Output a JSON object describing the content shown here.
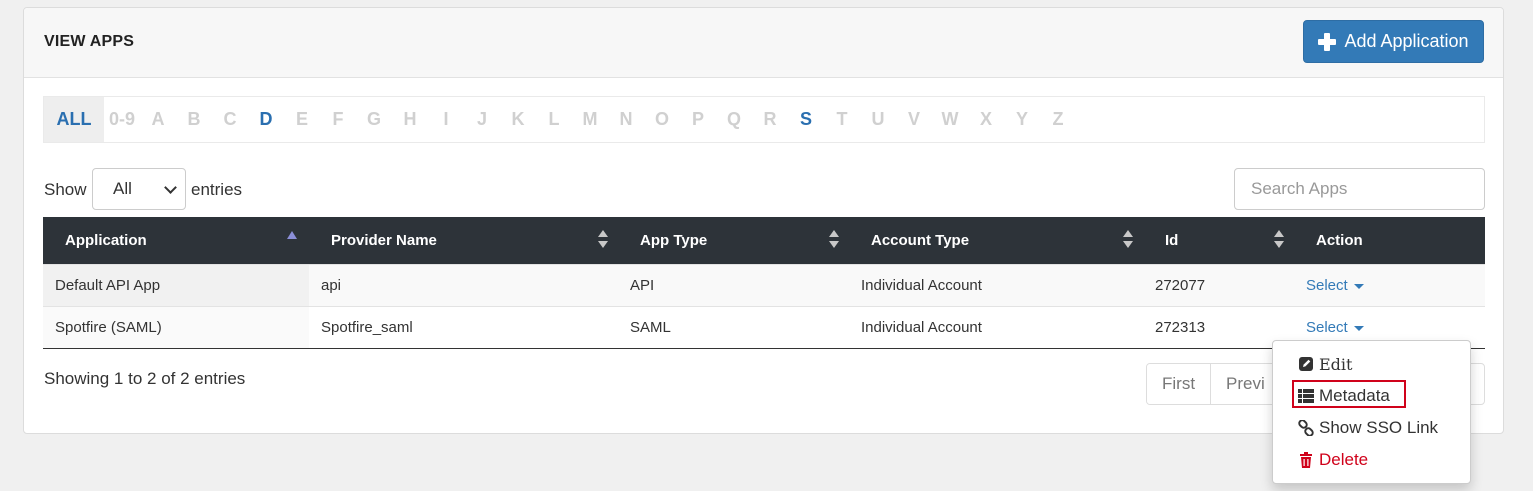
{
  "header": {
    "title": "VIEW APPS",
    "add_button_label": "Add Application"
  },
  "alphabet": {
    "items": [
      "ALL",
      "0-9",
      "A",
      "B",
      "C",
      "D",
      "E",
      "F",
      "G",
      "H",
      "I",
      "J",
      "K",
      "L",
      "M",
      "N",
      "O",
      "P",
      "Q",
      "R",
      "S",
      "T",
      "U",
      "V",
      "W",
      "X",
      "Y",
      "Z"
    ],
    "selected": "ALL",
    "active": [
      "D",
      "S"
    ]
  },
  "controls": {
    "show_label": "Show",
    "entries_value": "All",
    "entries_label": "entries",
    "search_placeholder": "Search Apps"
  },
  "table": {
    "columns": [
      "Application",
      "Provider Name",
      "App Type",
      "Account Type",
      "Id",
      "Action"
    ],
    "sort_column": "Application",
    "sort_direction": "ascending",
    "rows": [
      {
        "application": "Default API App",
        "provider": "api",
        "app_type": "API",
        "account_type": "Individual Account",
        "id": "272077",
        "action": "Select"
      },
      {
        "application": "Spotfire (SAML)",
        "provider": "Spotfire_saml",
        "app_type": "SAML",
        "account_type": "Individual Account",
        "id": "272313",
        "action": "Select"
      }
    ]
  },
  "footer": {
    "info": "Showing 1 to 2 of 2 entries",
    "pager": [
      "First",
      "Previ"
    ]
  },
  "action_menu": {
    "items": [
      {
        "label": "Edit",
        "icon": "edit-icon"
      },
      {
        "label": "Metadata",
        "icon": "list-icon",
        "highlighted": true
      },
      {
        "label": "Show SSO Link",
        "icon": "link-icon"
      },
      {
        "label": "Delete",
        "icon": "trash-icon",
        "color": "#d0021b"
      }
    ]
  },
  "colors": {
    "primary": "#337ab7",
    "table_header": "#2d3339",
    "danger": "#d0021b"
  }
}
